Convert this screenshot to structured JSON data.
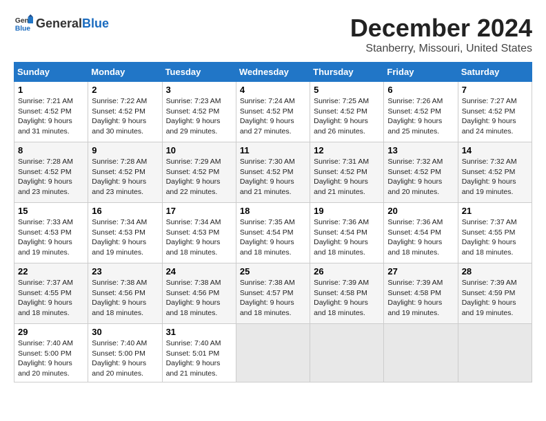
{
  "logo": {
    "general": "General",
    "blue": "Blue"
  },
  "title": {
    "month": "December 2024",
    "location": "Stanberry, Missouri, United States"
  },
  "calendar": {
    "headers": [
      "Sunday",
      "Monday",
      "Tuesday",
      "Wednesday",
      "Thursday",
      "Friday",
      "Saturday"
    ],
    "weeks": [
      [
        {
          "day": "1",
          "sunrise": "7:21 AM",
          "sunset": "4:52 PM",
          "daylight": "9 hours and 31 minutes."
        },
        {
          "day": "2",
          "sunrise": "7:22 AM",
          "sunset": "4:52 PM",
          "daylight": "9 hours and 30 minutes."
        },
        {
          "day": "3",
          "sunrise": "7:23 AM",
          "sunset": "4:52 PM",
          "daylight": "9 hours and 29 minutes."
        },
        {
          "day": "4",
          "sunrise": "7:24 AM",
          "sunset": "4:52 PM",
          "daylight": "9 hours and 27 minutes."
        },
        {
          "day": "5",
          "sunrise": "7:25 AM",
          "sunset": "4:52 PM",
          "daylight": "9 hours and 26 minutes."
        },
        {
          "day": "6",
          "sunrise": "7:26 AM",
          "sunset": "4:52 PM",
          "daylight": "9 hours and 25 minutes."
        },
        {
          "day": "7",
          "sunrise": "7:27 AM",
          "sunset": "4:52 PM",
          "daylight": "9 hours and 24 minutes."
        }
      ],
      [
        {
          "day": "8",
          "sunrise": "7:28 AM",
          "sunset": "4:52 PM",
          "daylight": "9 hours and 23 minutes."
        },
        {
          "day": "9",
          "sunrise": "7:28 AM",
          "sunset": "4:52 PM",
          "daylight": "9 hours and 23 minutes."
        },
        {
          "day": "10",
          "sunrise": "7:29 AM",
          "sunset": "4:52 PM",
          "daylight": "9 hours and 22 minutes."
        },
        {
          "day": "11",
          "sunrise": "7:30 AM",
          "sunset": "4:52 PM",
          "daylight": "9 hours and 21 minutes."
        },
        {
          "day": "12",
          "sunrise": "7:31 AM",
          "sunset": "4:52 PM",
          "daylight": "9 hours and 21 minutes."
        },
        {
          "day": "13",
          "sunrise": "7:32 AM",
          "sunset": "4:52 PM",
          "daylight": "9 hours and 20 minutes."
        },
        {
          "day": "14",
          "sunrise": "7:32 AM",
          "sunset": "4:52 PM",
          "daylight": "9 hours and 19 minutes."
        }
      ],
      [
        {
          "day": "15",
          "sunrise": "7:33 AM",
          "sunset": "4:53 PM",
          "daylight": "9 hours and 19 minutes."
        },
        {
          "day": "16",
          "sunrise": "7:34 AM",
          "sunset": "4:53 PM",
          "daylight": "9 hours and 19 minutes."
        },
        {
          "day": "17",
          "sunrise": "7:34 AM",
          "sunset": "4:53 PM",
          "daylight": "9 hours and 18 minutes."
        },
        {
          "day": "18",
          "sunrise": "7:35 AM",
          "sunset": "4:54 PM",
          "daylight": "9 hours and 18 minutes."
        },
        {
          "day": "19",
          "sunrise": "7:36 AM",
          "sunset": "4:54 PM",
          "daylight": "9 hours and 18 minutes."
        },
        {
          "day": "20",
          "sunrise": "7:36 AM",
          "sunset": "4:54 PM",
          "daylight": "9 hours and 18 minutes."
        },
        {
          "day": "21",
          "sunrise": "7:37 AM",
          "sunset": "4:55 PM",
          "daylight": "9 hours and 18 minutes."
        }
      ],
      [
        {
          "day": "22",
          "sunrise": "7:37 AM",
          "sunset": "4:55 PM",
          "daylight": "9 hours and 18 minutes."
        },
        {
          "day": "23",
          "sunrise": "7:38 AM",
          "sunset": "4:56 PM",
          "daylight": "9 hours and 18 minutes."
        },
        {
          "day": "24",
          "sunrise": "7:38 AM",
          "sunset": "4:56 PM",
          "daylight": "9 hours and 18 minutes."
        },
        {
          "day": "25",
          "sunrise": "7:38 AM",
          "sunset": "4:57 PM",
          "daylight": "9 hours and 18 minutes."
        },
        {
          "day": "26",
          "sunrise": "7:39 AM",
          "sunset": "4:58 PM",
          "daylight": "9 hours and 18 minutes."
        },
        {
          "day": "27",
          "sunrise": "7:39 AM",
          "sunset": "4:58 PM",
          "daylight": "9 hours and 19 minutes."
        },
        {
          "day": "28",
          "sunrise": "7:39 AM",
          "sunset": "4:59 PM",
          "daylight": "9 hours and 19 minutes."
        }
      ],
      [
        {
          "day": "29",
          "sunrise": "7:40 AM",
          "sunset": "5:00 PM",
          "daylight": "9 hours and 20 minutes."
        },
        {
          "day": "30",
          "sunrise": "7:40 AM",
          "sunset": "5:00 PM",
          "daylight": "9 hours and 20 minutes."
        },
        {
          "day": "31",
          "sunrise": "7:40 AM",
          "sunset": "5:01 PM",
          "daylight": "9 hours and 21 minutes."
        },
        null,
        null,
        null,
        null
      ]
    ]
  }
}
